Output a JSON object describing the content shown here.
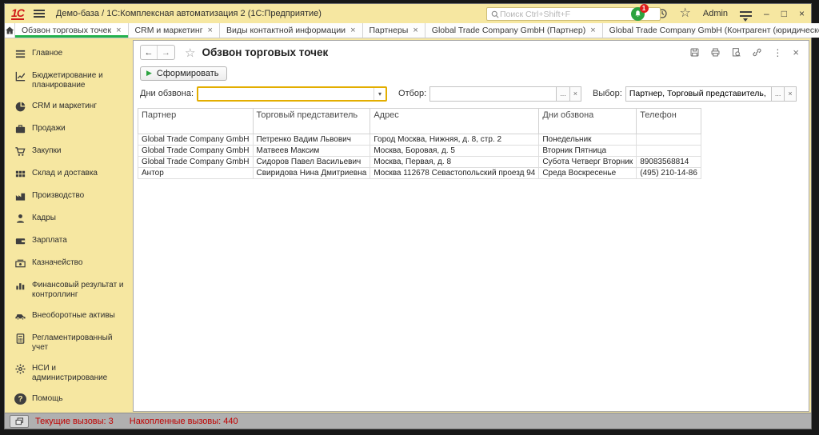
{
  "titlebar": {
    "logo": "1С",
    "title": "Демо-база / 1С:Комплексная автоматизация 2  (1С:Предприятие)",
    "search_placeholder": "Поиск Ctrl+Shift+F",
    "notification_badge": "1",
    "user": "Admin"
  },
  "tabs": [
    {
      "label": "Обзвон торговых точек"
    },
    {
      "label": "CRM и маркетинг"
    },
    {
      "label": "Виды контактной информации"
    },
    {
      "label": "Партнеры"
    },
    {
      "label": "Global Trade Company GmbH (Партнер)"
    },
    {
      "label": "Global Trade Company GmbH (Контрагент (юридическое или физическое ..."
    }
  ],
  "sidebar": {
    "items": [
      {
        "label": "Главное"
      },
      {
        "label": "Бюджетирование и планирование"
      },
      {
        "label": "CRM и маркетинг"
      },
      {
        "label": "Продажи"
      },
      {
        "label": "Закупки"
      },
      {
        "label": "Склад и доставка"
      },
      {
        "label": "Производство"
      },
      {
        "label": "Кадры"
      },
      {
        "label": "Зарплата"
      },
      {
        "label": "Казначейство"
      },
      {
        "label": "Финансовый результат и контроллинг"
      },
      {
        "label": "Внеоборотные активы"
      },
      {
        "label": "Регламентированный учет"
      },
      {
        "label": "НСИ и администрирование"
      },
      {
        "label": "Помощь"
      }
    ]
  },
  "report": {
    "title": "Обзвон торговых точек",
    "generate_label": "Сформировать",
    "filters": {
      "days_label": "Дни обзвона:",
      "days_value": "",
      "selection_label": "Отбор:",
      "selection_value": "",
      "fields_label": "Выбор:",
      "fields_value": "Партнер, Торговый представитель, Адрес, Дн"
    },
    "table": {
      "columns": [
        "Партнер",
        "Торговый представитель",
        "Адрес",
        "Дни обзвона",
        "Телефон"
      ],
      "rows": [
        [
          "Global Trade Company GmbH",
          "Петренко Вадим Львович",
          "Город Москва, Нижняя, д. 8, стр. 2",
          "Понедельник",
          ""
        ],
        [
          "Global Trade Company GmbH",
          "Матвеев Максим",
          "Москва, Боровая, д. 5",
          "Вторник Пятница",
          ""
        ],
        [
          "Global Trade Company GmbH",
          "Сидоров Павел Васильевич",
          "Москва, Первая, д. 8",
          "Субота Четверг Вторник",
          "89083568814"
        ],
        [
          "Антор",
          "Свиридова Нина Дмитриевна",
          "Москва 112678 Севастопольский проезд 94",
          "Среда Воскресенье",
          "(495) 210-14-86"
        ]
      ]
    }
  },
  "statusbar": {
    "current_calls": "Текущие вызовы: 3",
    "accumulated_calls": "Накопленные вызовы: 440"
  },
  "glyphs": {
    "close": "×",
    "back": "←",
    "forward": "→",
    "star": "☆",
    "dots": "⋮",
    "caret": "▾",
    "ellipsis": "...",
    "play": "▶",
    "minimize": "–",
    "maximize": "□",
    "question": "?"
  },
  "colors": {
    "accent_green": "#23b14d",
    "panel_yellow": "#f6e7a1",
    "required_field_border": "#e3ae00",
    "status_red": "#c00000"
  }
}
